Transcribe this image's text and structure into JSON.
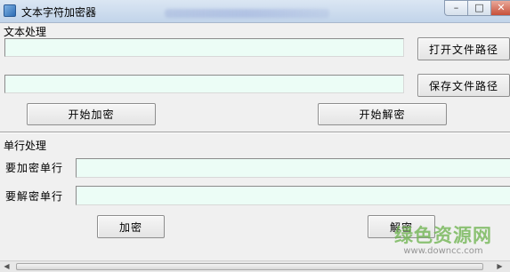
{
  "window": {
    "title": "文本字符加密器",
    "minimize": "–",
    "maximize": "□",
    "close": "✕"
  },
  "text_section": {
    "label": "文本处理",
    "input_path": "",
    "output_path": "",
    "open_button": "打开文件路径",
    "save_button": "保存文件路径",
    "start_encrypt": "开始加密",
    "start_decrypt": "开始解密"
  },
  "line_section": {
    "label": "单行处理",
    "encrypt_row_label": "要加密单行",
    "decrypt_row_label": "要解密单行",
    "encrypt_value": "",
    "decrypt_value": "",
    "encrypt_button": "加密",
    "decrypt_button": "解密"
  },
  "watermark": {
    "logo": "绿色资源网",
    "url": "www.downcc.com"
  },
  "scrollbar": {
    "left_arrow": "◀",
    "right_arrow": "▶"
  }
}
